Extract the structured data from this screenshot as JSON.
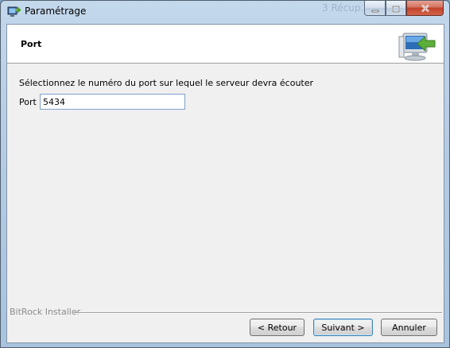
{
  "window": {
    "title": "Paramétrage",
    "background_text": "3 Récup...",
    "controls": {
      "minimize": "minimize-icon",
      "maximize": "maximize-icon",
      "close": "close-icon"
    }
  },
  "header": {
    "title": "Port",
    "icon": "computer-arrow-icon"
  },
  "content": {
    "instruction": "Sélectionnez le numéro du port sur lequel le serveur devra écouter",
    "port_label": "Port",
    "port_value": "5434"
  },
  "footer": {
    "installer_label": "BitRock Installer",
    "back_label": "< Retour",
    "next_label": "Suivant >",
    "cancel_label": "Annuler"
  },
  "colors": {
    "titlebar": "#b5cce4",
    "client_bg": "#f0f0f0",
    "header_bg": "#ffffff",
    "close_button": "#c2422a",
    "focus_border": "#3c7fb1"
  }
}
